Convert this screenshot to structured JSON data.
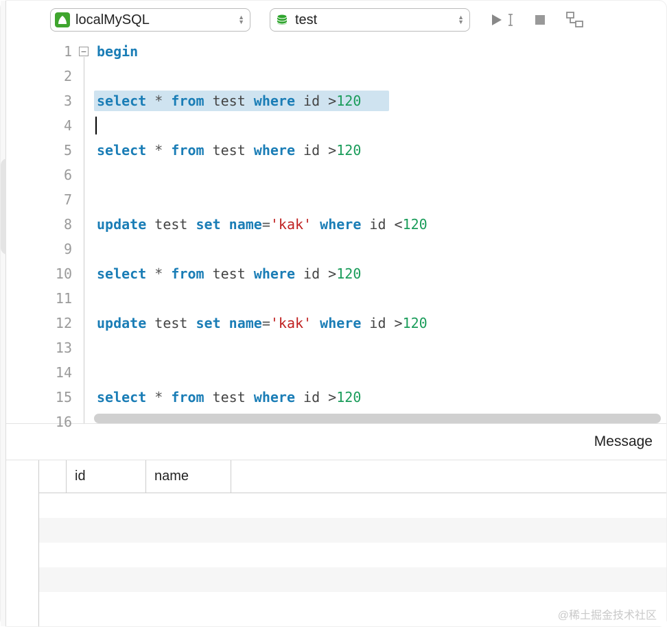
{
  "toolbar": {
    "connection_name": "localMySQL",
    "database_name": "test"
  },
  "editor": {
    "line_start": 1,
    "line_count": 16,
    "selected_line": 3,
    "cursor_line": 4,
    "code_lines": [
      {
        "n": 1,
        "tokens": [
          {
            "t": "begin",
            "c": "kw"
          }
        ]
      },
      {
        "n": 2,
        "tokens": []
      },
      {
        "n": 3,
        "tokens": [
          {
            "t": "select",
            "c": "kw"
          },
          {
            "t": " * ",
            "c": "op"
          },
          {
            "t": "from",
            "c": "kw"
          },
          {
            "t": " test ",
            "c": "ident"
          },
          {
            "t": "where",
            "c": "kw"
          },
          {
            "t": " id >",
            "c": "ident"
          },
          {
            "t": "120",
            "c": "num"
          }
        ]
      },
      {
        "n": 4,
        "tokens": []
      },
      {
        "n": 5,
        "tokens": [
          {
            "t": "select",
            "c": "kw"
          },
          {
            "t": " * ",
            "c": "op"
          },
          {
            "t": "from",
            "c": "kw"
          },
          {
            "t": " test ",
            "c": "ident"
          },
          {
            "t": "where",
            "c": "kw"
          },
          {
            "t": " id >",
            "c": "ident"
          },
          {
            "t": "120",
            "c": "num"
          }
        ]
      },
      {
        "n": 6,
        "tokens": []
      },
      {
        "n": 7,
        "tokens": []
      },
      {
        "n": 8,
        "tokens": [
          {
            "t": "update",
            "c": "kw"
          },
          {
            "t": " test ",
            "c": "ident"
          },
          {
            "t": "set",
            "c": "kw"
          },
          {
            "t": " ",
            "c": "ident"
          },
          {
            "t": "name",
            "c": "kw"
          },
          {
            "t": "=",
            "c": "op"
          },
          {
            "t": "'kak'",
            "c": "str"
          },
          {
            "t": " ",
            "c": "ident"
          },
          {
            "t": "where",
            "c": "kw"
          },
          {
            "t": " id <",
            "c": "ident"
          },
          {
            "t": "120",
            "c": "num"
          }
        ]
      },
      {
        "n": 9,
        "tokens": []
      },
      {
        "n": 10,
        "tokens": [
          {
            "t": "select",
            "c": "kw"
          },
          {
            "t": " * ",
            "c": "op"
          },
          {
            "t": "from",
            "c": "kw"
          },
          {
            "t": " test ",
            "c": "ident"
          },
          {
            "t": "where",
            "c": "kw"
          },
          {
            "t": " id >",
            "c": "ident"
          },
          {
            "t": "120",
            "c": "num"
          }
        ]
      },
      {
        "n": 11,
        "tokens": []
      },
      {
        "n": 12,
        "tokens": [
          {
            "t": "update",
            "c": "kw"
          },
          {
            "t": " test ",
            "c": "ident"
          },
          {
            "t": "set",
            "c": "kw"
          },
          {
            "t": " ",
            "c": "ident"
          },
          {
            "t": "name",
            "c": "kw"
          },
          {
            "t": "=",
            "c": "op"
          },
          {
            "t": "'kak'",
            "c": "str"
          },
          {
            "t": " ",
            "c": "ident"
          },
          {
            "t": "where",
            "c": "kw"
          },
          {
            "t": " id >",
            "c": "ident"
          },
          {
            "t": "120",
            "c": "num"
          }
        ]
      },
      {
        "n": 13,
        "tokens": []
      },
      {
        "n": 14,
        "tokens": []
      },
      {
        "n": 15,
        "tokens": [
          {
            "t": "select",
            "c": "kw"
          },
          {
            "t": " * ",
            "c": "op"
          },
          {
            "t": "from",
            "c": "kw"
          },
          {
            "t": " test ",
            "c": "ident"
          },
          {
            "t": "where",
            "c": "kw"
          },
          {
            "t": " id >",
            "c": "ident"
          },
          {
            "t": "120",
            "c": "num"
          }
        ]
      },
      {
        "n": 16,
        "tokens": []
      }
    ]
  },
  "message_bar": {
    "label": "Message"
  },
  "results": {
    "columns": [
      "id",
      "name"
    ],
    "rows": []
  },
  "watermark": "@稀土掘金技术社区"
}
